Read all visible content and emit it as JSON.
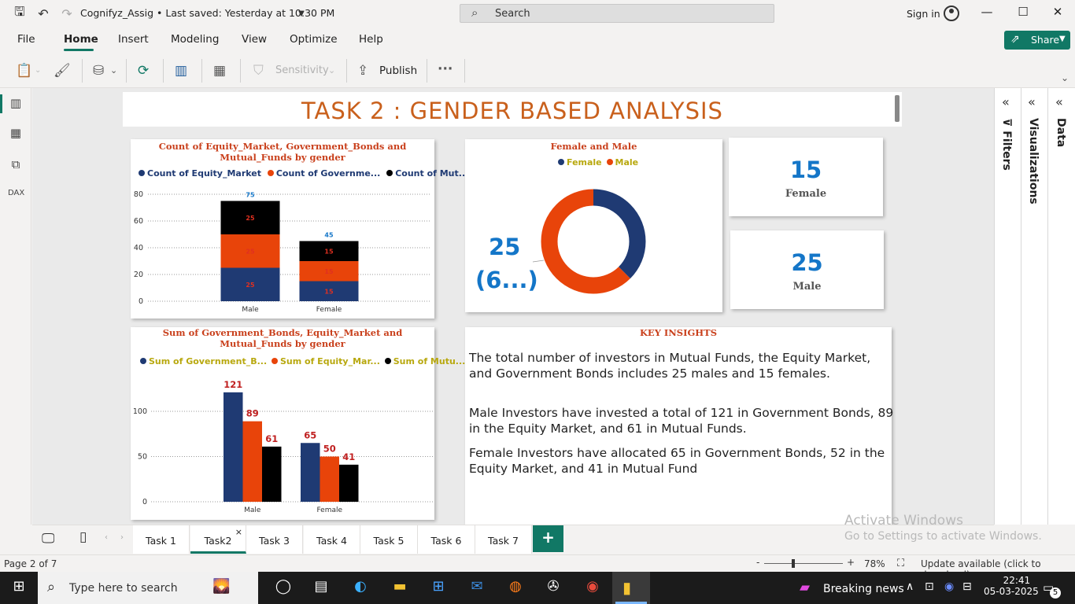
{
  "titlebar": {
    "doc_title": "Cognifyz_Assig • Last saved: Yesterday at 10:30 PM",
    "search_placeholder": "Search",
    "signin": "Sign in"
  },
  "menu": {
    "file": "File",
    "home": "Home",
    "insert": "Insert",
    "modeling": "Modeling",
    "view": "View",
    "optimize": "Optimize",
    "help": "Help",
    "share": "Share"
  },
  "ribbon": {
    "sensitivity": "Sensitivity",
    "publish": "Publish",
    "more": "···"
  },
  "report": {
    "title": "TASK 2 :  GENDER BASED ANALYSIS",
    "kpi_female": {
      "value": "15",
      "label": "Female"
    },
    "kpi_male": {
      "value": "25",
      "label": "Male"
    },
    "insights": {
      "title": "KEY INSIGHTS",
      "p1": "The total number of investors in Mutual Funds, the Equity Market, and Government Bonds includes 25 males and 15 females.",
      "p2": "Male Investors have invested a total of 121 in Government Bonds, 89 in the Equity Market, and 61 in Mutual Funds.",
      "p3": "Female Investors have allocated 65 in Government Bonds, 52 in the Equity Market, and 41 in Mutual Fund"
    }
  },
  "chart_data": [
    {
      "type": "bar",
      "stacked": true,
      "title": "Count of Equity_Market, Government_Bonds and Mutual_Funds by gender",
      "legend": [
        "Count of Equity_Market",
        "Count of Governme...",
        "Count of Mut..."
      ],
      "categories": [
        "Male",
        "Female"
      ],
      "series": [
        {
          "name": "Count of Equity_Market",
          "color": "#1f3a73",
          "values": [
            25,
            15
          ]
        },
        {
          "name": "Count of Governme...",
          "color": "#e8440a",
          "values": [
            25,
            15
          ]
        },
        {
          "name": "Count of Mut...",
          "color": "#000000",
          "values": [
            25,
            15
          ]
        }
      ],
      "totals": [
        "75",
        "45"
      ],
      "yticks": [
        "0",
        "20",
        "40",
        "60",
        "80"
      ],
      "ylim": [
        0,
        80
      ],
      "grid": true
    },
    {
      "type": "bar",
      "stacked": false,
      "title": "Sum of Government_Bonds, Equity_Market and Mutual_Funds by gender",
      "legend": [
        "Sum of Government_B...",
        "Sum of Equity_Mar...",
        "Sum of Mutu..."
      ],
      "categories": [
        "Male",
        "Female"
      ],
      "series": [
        {
          "name": "Sum of Government_B...",
          "color": "#1f3a73",
          "values": [
            121,
            65
          ]
        },
        {
          "name": "Sum of Equity_Mar...",
          "color": "#e8440a",
          "values": [
            89,
            50
          ]
        },
        {
          "name": "Sum of Mutu...",
          "color": "#000000",
          "values": [
            61,
            41
          ]
        }
      ],
      "yticks": [
        "0",
        "50",
        "100"
      ],
      "ylim": [
        0,
        135
      ],
      "grid": true
    },
    {
      "type": "pie",
      "donut": true,
      "title": "Female and Male",
      "legend": [
        "Female",
        "Male"
      ],
      "slices": [
        {
          "label": "Female",
          "value": 15,
          "color": "#1f3a73"
        },
        {
          "label": "Male",
          "value": 25,
          "color": "#e8440a"
        }
      ],
      "callout_value": "25",
      "callout_pct": "(6...)"
    }
  ],
  "tabs": [
    "Task 1",
    "Task2",
    "Task 3",
    "Task 4",
    "Task 5",
    "Task 6",
    "Task 7"
  ],
  "active_tab": "Task2",
  "activate": {
    "line1": "Activate Windows",
    "line2": "Go to Settings to activate Windows."
  },
  "panes": {
    "filters": "Filters",
    "visualizations": "Visualizations",
    "data": "Data"
  },
  "status": {
    "page": "Page 2 of 7",
    "zoom": "78%",
    "update": "Update available (click to download)"
  },
  "taskbar": {
    "search_placeholder": "Type here to search",
    "news": "Breaking news",
    "time": "22:41",
    "date": "05-03-2025",
    "notif_count": "5"
  }
}
